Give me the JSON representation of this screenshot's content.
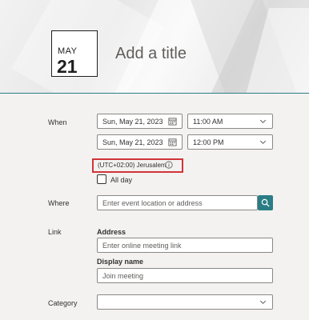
{
  "header": {
    "month": "MAY",
    "day": "21",
    "title_placeholder": "Add a title"
  },
  "when": {
    "label": "When",
    "start_date": "Sun, May 21, 2023",
    "start_time": "11:00 AM",
    "end_date": "Sun, May 21, 2023",
    "end_time": "12:00 PM",
    "timezone": "(UTC+02:00) Jerusalem",
    "all_day_label": "All day"
  },
  "where": {
    "label": "Where",
    "placeholder": "Enter event location or address"
  },
  "link": {
    "label": "Link",
    "address_label": "Address",
    "address_placeholder": "Enter online meeting link",
    "display_name_label": "Display name",
    "display_name_placeholder": "Join meeting"
  },
  "category": {
    "label": "Category",
    "value": ""
  },
  "colors": {
    "accent": "#2a7d84",
    "highlight": "#d13438"
  },
  "icons": [
    "calendar-icon",
    "chevron-down-icon",
    "info-icon",
    "search-icon"
  ]
}
